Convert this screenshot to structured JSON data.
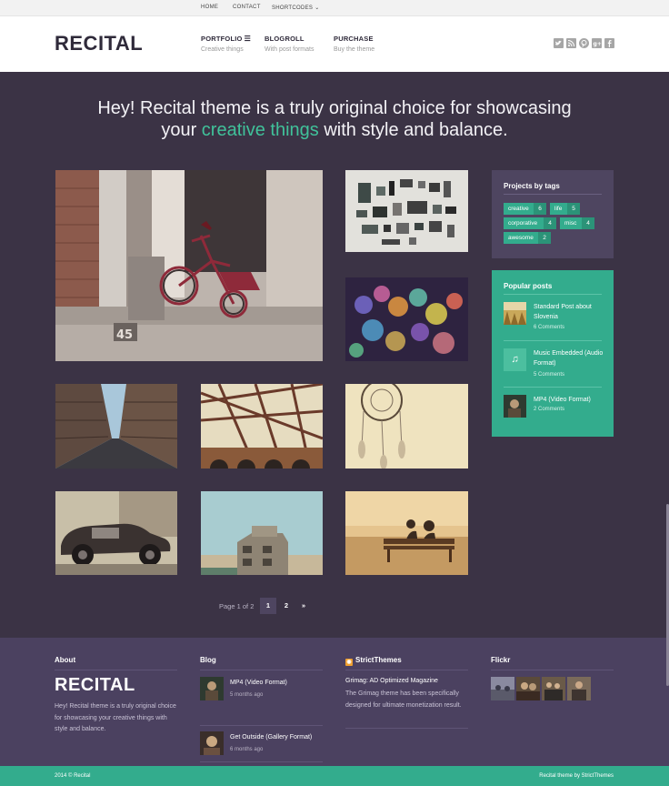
{
  "topnav": {
    "home": "HOME",
    "contact": "CONTACT",
    "shortcodes": "SHORTCODES ⌄"
  },
  "header": {
    "logo": "RECITAL",
    "nav": [
      {
        "title": "PORTFOLIO",
        "sub": "Creative things"
      },
      {
        "title": "BLOGROLL",
        "sub": "With post formats"
      },
      {
        "title": "PURCHASE",
        "sub": "Buy the theme"
      }
    ],
    "menu_icon": "☰",
    "social_icons": [
      "twitter-icon",
      "rss-icon",
      "pinterest-icon",
      "googleplus-icon",
      "facebook-icon"
    ]
  },
  "hero": {
    "line1": "Hey! Recital theme is a truly original choice for showcasing",
    "line2_before": "your ",
    "line2_accent": "creative things",
    "line2_after": " with style and balance."
  },
  "gallery": [
    {
      "name": "tricycle"
    },
    {
      "name": "gadgets-flatlay"
    },
    {
      "name": "bokeh-lights"
    },
    {
      "name": "city-street"
    },
    {
      "name": "bridge-structure"
    },
    {
      "name": "dreamcatcher"
    },
    {
      "name": "vintage-car"
    },
    {
      "name": "old-building"
    },
    {
      "name": "couple-on-bench"
    }
  ],
  "sidebar": {
    "tags_title": "Projects by tags",
    "tags": [
      {
        "label": "creative",
        "count": "6"
      },
      {
        "label": "life",
        "count": "5"
      },
      {
        "label": "corporative",
        "count": "4"
      },
      {
        "label": "misc",
        "count": "4"
      },
      {
        "label": "awesome",
        "count": "2"
      }
    ],
    "posts_title": "Popular posts",
    "posts": [
      {
        "title": "Standard Post about Slovenia",
        "meta": "6 Comments"
      },
      {
        "title": "Music Embedded (Audio Format)",
        "meta": "5 Comments"
      },
      {
        "title": "MP4 (Video Format)",
        "meta": "2 Comments"
      }
    ],
    "music_icon": "♫"
  },
  "pagination": {
    "label": "Page 1 of 2",
    "pages": [
      "1",
      "2"
    ],
    "next": "»",
    "current": "1"
  },
  "footer": {
    "about_title": "About",
    "about_logo": "RECITAL",
    "about_text": "Hey! Recital theme is a truly original choice for showcasing your creative things with style and balance.",
    "blog_title": "Blog",
    "blog_posts": [
      {
        "title": "MP4 (Video Format)",
        "meta": "5 months ago"
      },
      {
        "title": "Get Outside (Gallery Format)",
        "meta": "6 months ago"
      }
    ],
    "st_title": "StrictThemes",
    "st_post_title": "Grimag: AD Optimized Magazine",
    "st_post_body": "The Grimag theme has been specifically designed for ultimate monetization result.",
    "flickr_title": "Flickr"
  },
  "bottombar": {
    "left": "2014 © Recital",
    "right": "Recital theme by StrictThemes"
  },
  "colors": {
    "accent": "#33ac8d",
    "background": "#3b3345",
    "footer": "#4b4160",
    "dark_text": "#2f2a3a"
  }
}
